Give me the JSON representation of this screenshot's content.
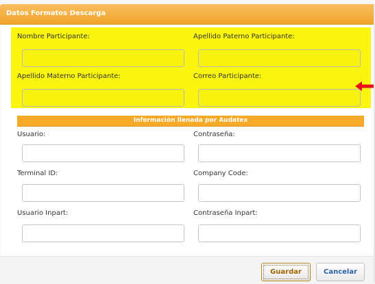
{
  "dialog": {
    "title": "Datos Formatos Descarga"
  },
  "participant": {
    "nombre_label": "Nombre Participante:",
    "nombre_value": "",
    "apellido_paterno_label": "Apellido Paterno Participante:",
    "apellido_paterno_value": "",
    "apellido_materno_label": "Apellido Materno Participante:",
    "apellido_materno_value": "",
    "correo_label": "Correo Participante:",
    "correo_value": ""
  },
  "audatex": {
    "section_title": "Información llenada por Audatex",
    "usuario_label": "Usuario:",
    "usuario_value": "",
    "contrasena_label": "Contraseña:",
    "contrasena_value": "",
    "terminal_label": "Terminal ID:",
    "terminal_value": "",
    "company_label": "Company Code:",
    "company_value": "",
    "usuario_inpart_label": "Usuario Inpart:",
    "usuario_inpart_value": "",
    "contrasena_inpart_label": "Contraseña Inpart:",
    "contrasena_inpart_value": ""
  },
  "buttons": {
    "guardar": "Guardar",
    "cancelar": "Cancelar"
  },
  "colors": {
    "title_bar": "#f2a42c",
    "highlight": "#f9f50f",
    "annotation_arrow": "#e8111b",
    "button_text": "#2a5ea6"
  },
  "icons": {
    "annotation": "left-arrow-icon"
  }
}
